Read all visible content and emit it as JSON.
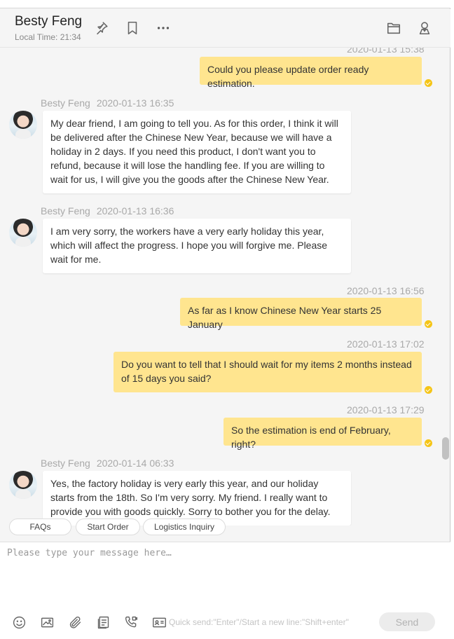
{
  "header": {
    "contact_name": "Besty Feng",
    "local_time": "Local Time: 21:34",
    "icons": [
      "pin-icon",
      "bookmark-icon",
      "more-icon",
      "folder-icon",
      "profile-icon"
    ]
  },
  "messages": [
    {
      "direction": "out",
      "time": "2020-01-13 15:38",
      "text": "Could you please update order ready estimation."
    },
    {
      "direction": "in",
      "sender": "Besty Feng",
      "time": "2020-01-13 16:35",
      "text": "My dear friend, I am going to tell you. As for this order, I think it will be delivered after the Chinese New Year, because we will have a holiday in 2 days. If you need this product, I don't want you to refund, because it will lose the handling fee. If you are willing to wait for us, I will give you the goods after the Chinese New Year."
    },
    {
      "direction": "in",
      "sender": "Besty Feng",
      "time": "2020-01-13 16:36",
      "text": "I am very sorry, the workers have a very early holiday this year, which will affect the progress. I hope you will forgive me. Please wait for me."
    },
    {
      "direction": "out",
      "time": "2020-01-13 16:56",
      "text": "As far as I know Chinese New Year starts 25 January"
    },
    {
      "direction": "out",
      "time": "2020-01-13 17:02",
      "text": "Do you want to tell that I should wait for my items 2 months instead of 15 days you said?"
    },
    {
      "direction": "out",
      "time": "2020-01-13 17:29",
      "text": "So the estimation is end of February, right?"
    },
    {
      "direction": "in",
      "sender": "Besty Feng",
      "time": "2020-01-14 06:33",
      "text": "Yes, the factory holiday is very early this year, and our holiday starts from the 18th. So I'm very sorry. My friend. I really want to provide you with goods quickly. Sorry to bother you for the delay."
    }
  ],
  "quick_replies": [
    "FAQs",
    "Start Order",
    "Logistics Inquiry"
  ],
  "composer": {
    "placeholder": "Please type your message here…",
    "value": "",
    "hint": "Quick send:\"Enter\"/Start a new line:\"Shift+enter\"",
    "send_label": "Send",
    "tools": [
      "emoji-icon",
      "image-icon",
      "attachment-icon",
      "product-card-icon",
      "video-call-icon",
      "business-card-icon"
    ]
  },
  "colors": {
    "outgoing_bubble": "#ffe58f",
    "incoming_bubble": "#ffffff",
    "read_indicator": "#f5c518",
    "background": "#f5f5f5"
  }
}
